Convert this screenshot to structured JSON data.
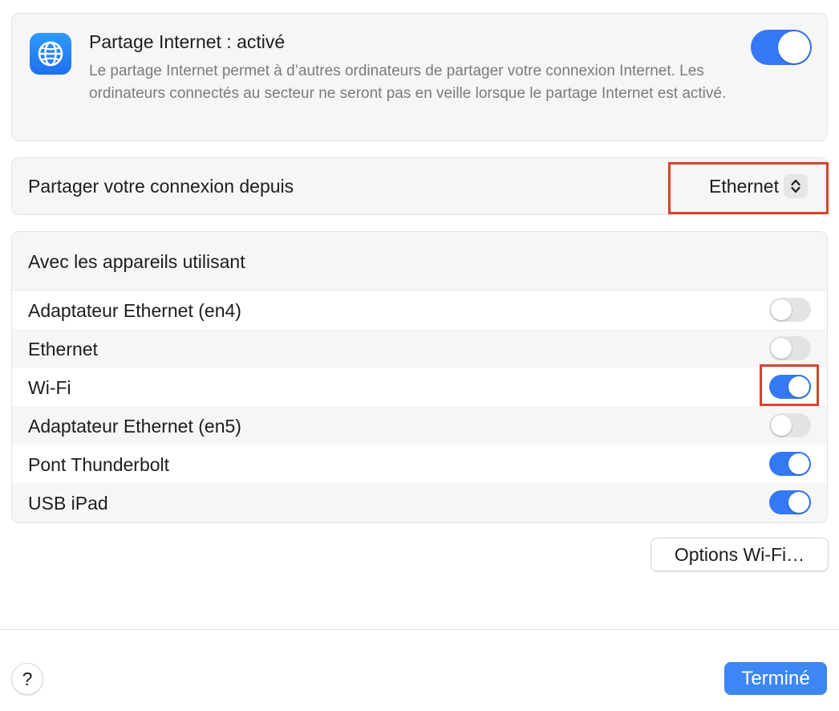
{
  "header": {
    "icon": "globe-icon",
    "title": "Partage Internet : activé",
    "description": "Le partage Internet permet à d’autres ordinateurs de partager votre connexion Internet. Les ordinateurs connectés au secteur ne seront pas en veille lorsque le partage Internet est activé.",
    "toggle_on": true
  },
  "share_from": {
    "label": "Partager votre connexion depuis",
    "selected": "Ethernet",
    "icon": "chevron-up-down-icon",
    "highlighted": true
  },
  "devices": {
    "header": "Avec les appareils utilisant",
    "items": [
      {
        "label": "Adaptateur Ethernet (en4)",
        "on": false,
        "highlighted": false
      },
      {
        "label": "Ethernet",
        "on": false,
        "highlighted": false
      },
      {
        "label": "Wi-Fi",
        "on": true,
        "highlighted": true
      },
      {
        "label": "Adaptateur Ethernet (en5)",
        "on": false,
        "highlighted": false
      },
      {
        "label": "Pont Thunderbolt",
        "on": true,
        "highlighted": false
      },
      {
        "label": "USB iPad",
        "on": true,
        "highlighted": false
      }
    ]
  },
  "buttons": {
    "options": "Options Wi-Fi…",
    "help": "?",
    "done": "Terminé"
  },
  "colors": {
    "accent": "#3478f6",
    "highlight": "#d9432f",
    "toggle_off": "#e3e3e3"
  }
}
